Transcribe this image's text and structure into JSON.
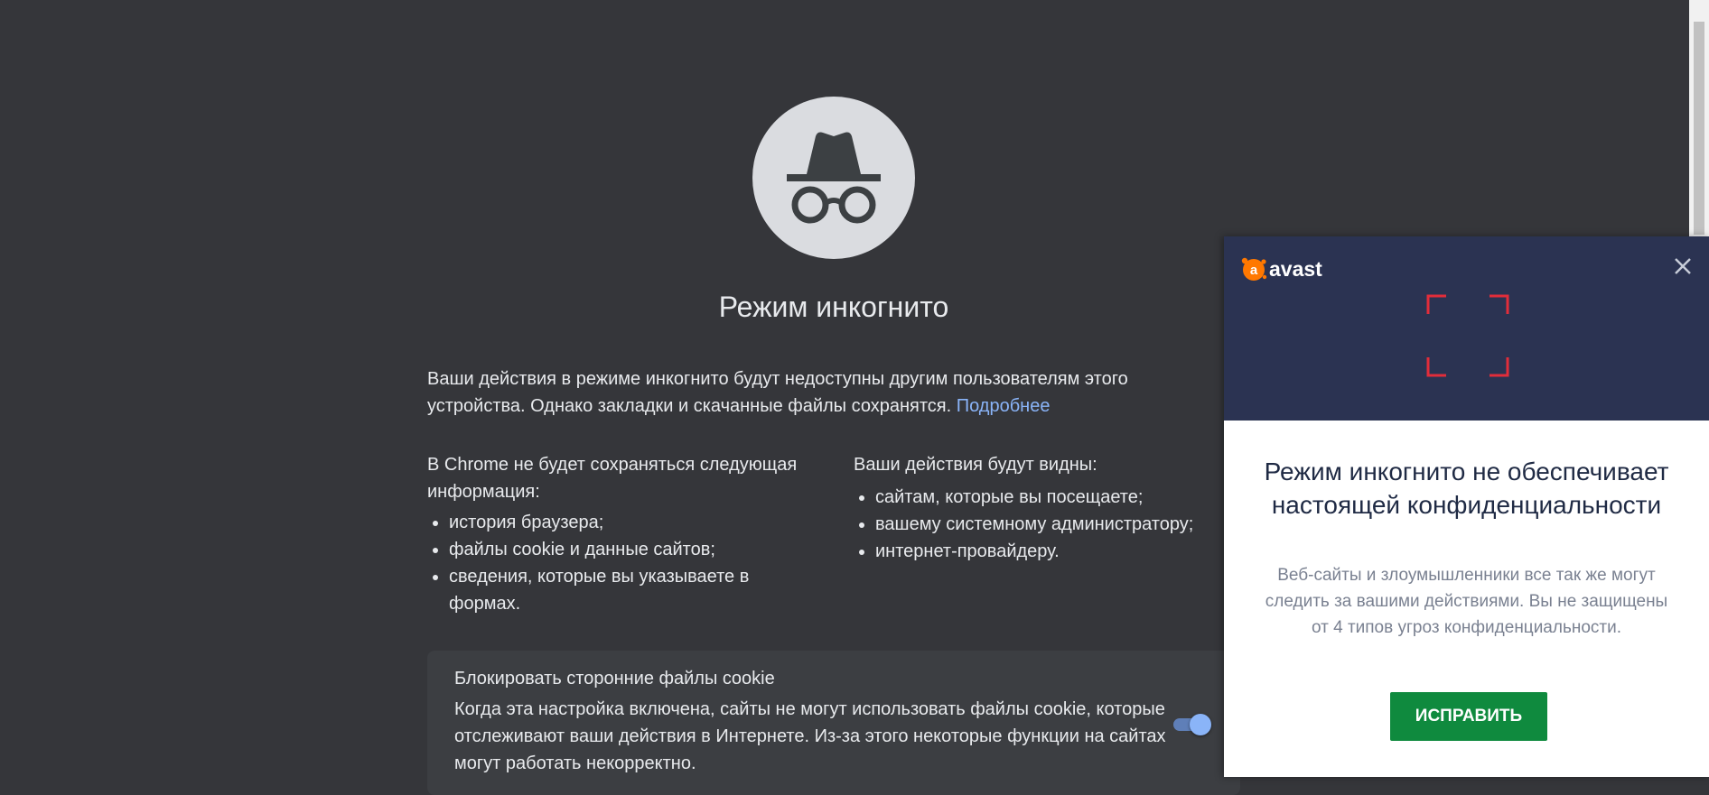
{
  "incognito": {
    "title": "Режим инкогнито",
    "intro_text": "Ваши действия в режиме инкогнито будут недоступны другим пользователям этого устройства. Однако закладки и скачанные файлы сохранятся. ",
    "learn_more": "Подробнее",
    "not_saved": {
      "heading": "В Chrome не будет сохраняться следующая информация:",
      "items": [
        "история браузера;",
        "файлы cookie и данные сайтов;",
        "сведения, которые вы указываете в формах."
      ]
    },
    "visible_to": {
      "heading": "Ваши действия будут видны:",
      "items": [
        "сайтам, которые вы посещаете;",
        "вашему системному администратору;",
        "интернет-провайдеру."
      ]
    },
    "cookie_block": {
      "title": "Блокировать сторонние файлы cookie",
      "description": "Когда эта настройка включена, сайты не могут использовать файлы cookie, которые отслеживают ваши действия в Интернете. Из-за этого некоторые функции на сайтах могут работать некорректно.",
      "toggle_on": true
    },
    "icon": "incognito-icon"
  },
  "avast_popup": {
    "brand": "avast",
    "title": "Режим инкогнито не обеспечивает настоящей конфиденциальности",
    "description": "Веб-сайты и злоумышленники все так же могут следить за вашими действиями. Вы не защищены от 4 типов угроз конфиденциальности.",
    "fix_button": "ИСПРАВИТЬ"
  },
  "colors": {
    "page_bg": "#35363a",
    "link": "#8ab4f8",
    "avast_header": "#2b3352",
    "avast_orange": "#ff7800",
    "scan_red": "#e22d3a",
    "fix_green": "#0f8a3e"
  }
}
